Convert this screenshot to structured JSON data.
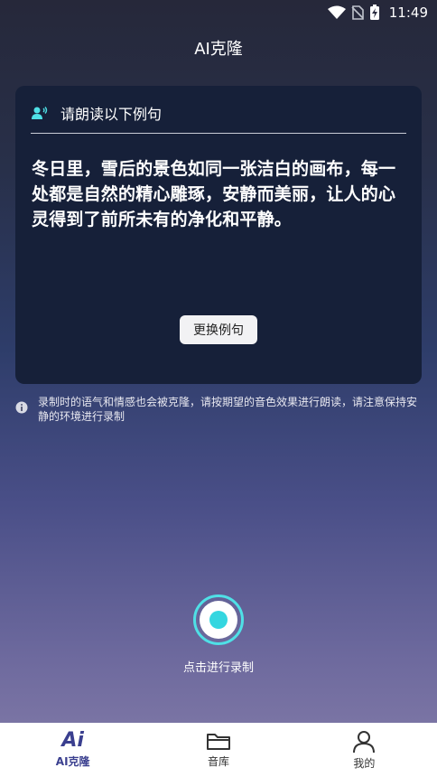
{
  "status_bar": {
    "time": "11:49"
  },
  "app": {
    "title": "AI克隆"
  },
  "card": {
    "header_label": "请朗读以下例句",
    "sample_text": "冬日里，雪后的景色如同一张洁白的画布，每一处都是自然的精心雕琢，安静而美丽，让人的心灵得到了前所未有的净化和平静。",
    "change_button": "更换例句"
  },
  "notice": {
    "text": "录制时的语气和情感也会被克隆，请按期望的音色效果进行朗读，请注意保持安静的环境进行录制"
  },
  "record": {
    "label": "点击进行录制"
  },
  "tabs": [
    {
      "label": "AI克隆",
      "icon": "ai-icon",
      "active": true
    },
    {
      "label": "音库",
      "icon": "folder-icon",
      "active": false
    },
    {
      "label": "我的",
      "icon": "person-icon",
      "active": false
    }
  ],
  "colors": {
    "accent": "#34d6e0",
    "card_bg": "#162039",
    "tab_active": "#3a3f8f"
  }
}
